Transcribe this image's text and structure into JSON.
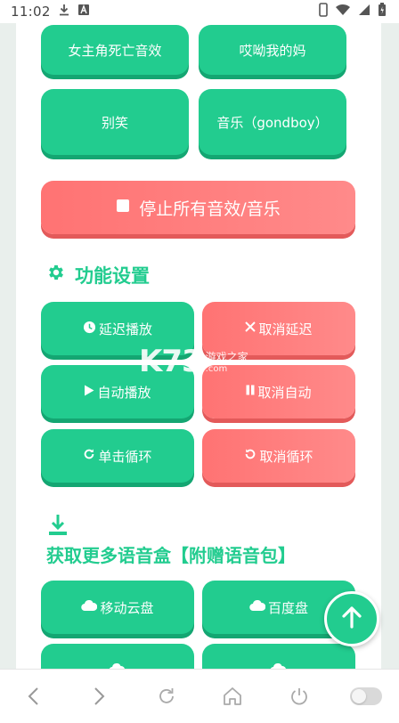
{
  "status_bar": {
    "time": "11:02",
    "icons_left": [
      "download-icon",
      "a-box-icon"
    ],
    "icons_right": [
      "phone-icon",
      "wifi-icon",
      "signal-icon",
      "battery-icon"
    ]
  },
  "sound_buttons": [
    {
      "label": "女主角死亡音效"
    },
    {
      "label": "哎呦我的妈"
    },
    {
      "label": "别笑"
    },
    {
      "label": "音乐（gondboy）"
    }
  ],
  "stop_button": {
    "label": "停止所有音效/音乐"
  },
  "settings": {
    "title": "功能设置",
    "buttons": [
      {
        "label": "延迟播放",
        "icon": "clock-icon"
      },
      {
        "label": "取消延迟",
        "icon": "x-icon"
      },
      {
        "label": "自动播放",
        "icon": "play-icon"
      },
      {
        "label": "取消自动",
        "icon": "pause-icon"
      },
      {
        "label": "单击循环",
        "icon": "loop-icon"
      },
      {
        "label": "取消循环",
        "icon": "undo-icon"
      }
    ]
  },
  "download": {
    "title": "获取更多语音盒【附赠语音包】",
    "buttons": [
      {
        "label": "移动云盘",
        "icon": "cloud-icon"
      },
      {
        "label": "百度盘",
        "icon": "cloud-icon"
      },
      {
        "label": "",
        "icon": "cloud-icon"
      },
      {
        "label": "",
        "icon": "cloud-icon"
      }
    ]
  },
  "watermark": {
    "logo": "K73",
    "cn": "游戏之家",
    "url": ".com"
  },
  "colors": {
    "green": "#22cc8f",
    "red": "#ff7a7a",
    "background": "#e9efec"
  }
}
